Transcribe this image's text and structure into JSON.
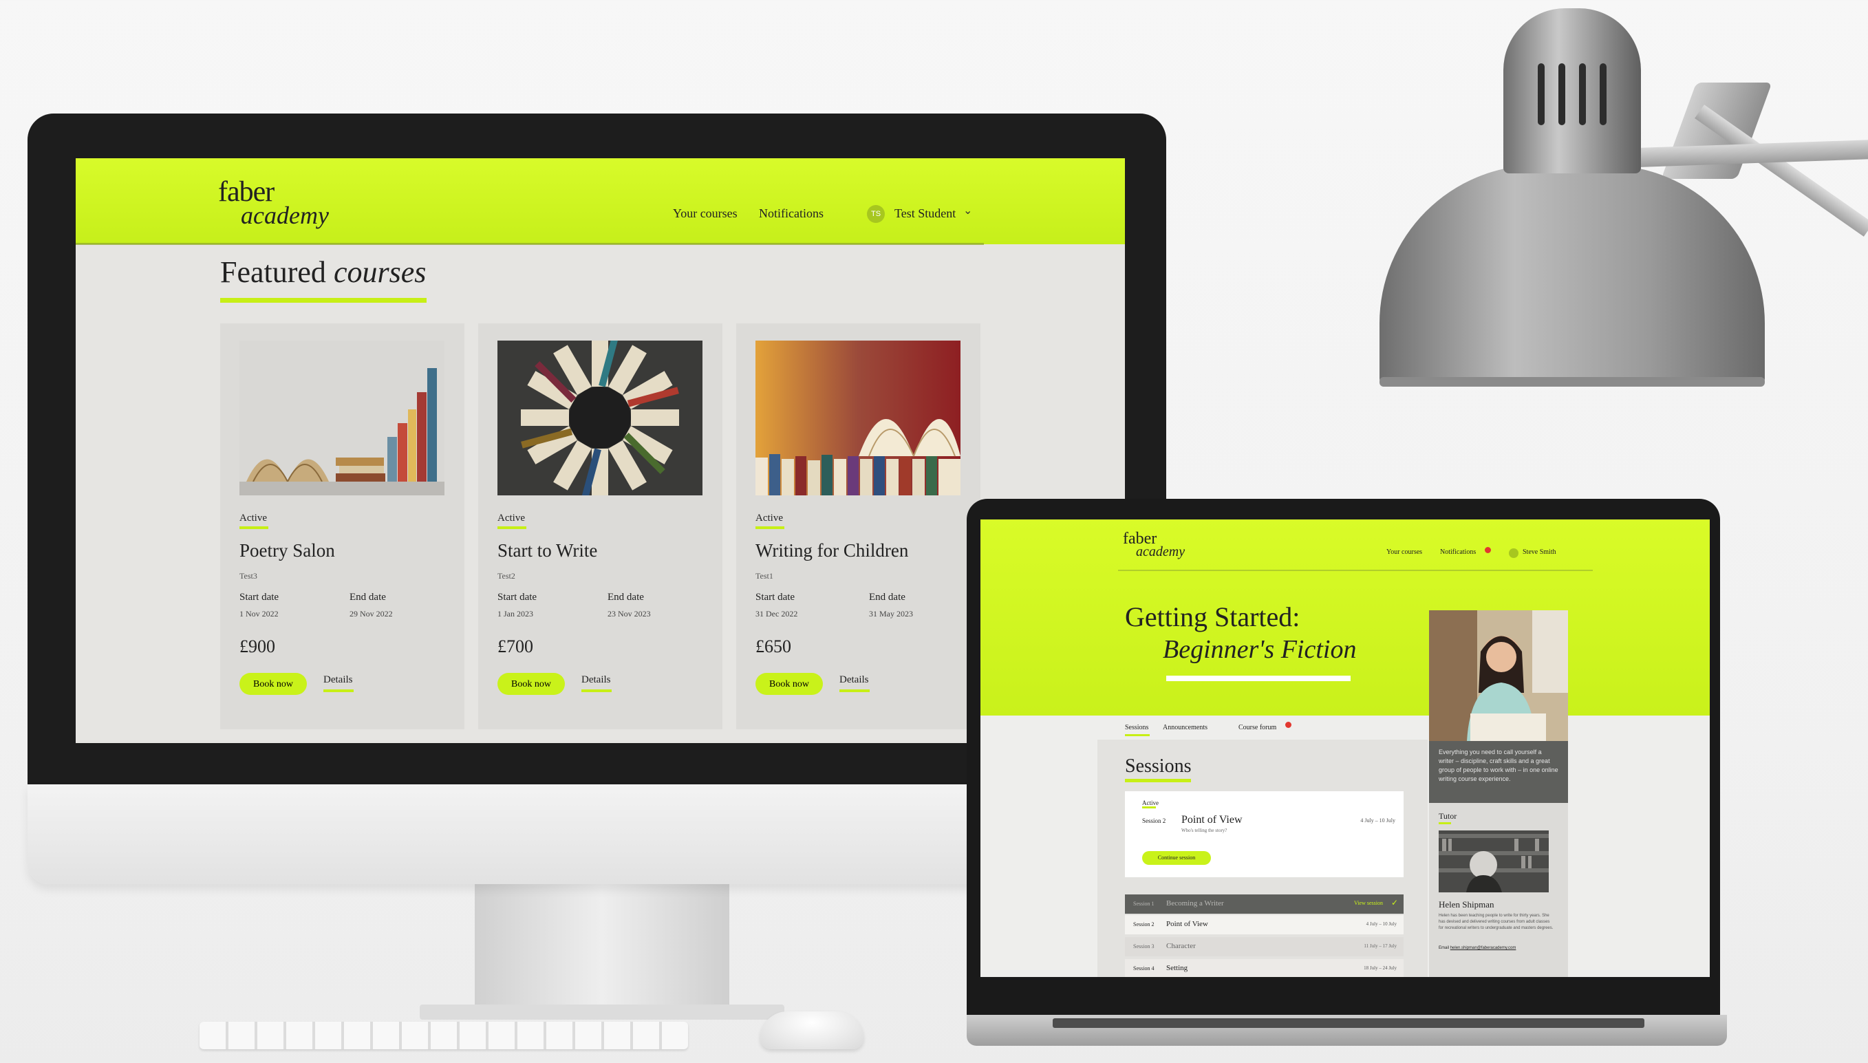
{
  "desktop": {
    "logo_line1": "faber",
    "logo_line2": "academy",
    "nav": {
      "your_courses": "Your courses",
      "notifications": "Notifications",
      "user_initials": "TS",
      "user_name": "Test Student"
    },
    "heading_plain": "Featured ",
    "heading_italic": "courses",
    "cards": [
      {
        "status": "Active",
        "title": "Poetry Salon",
        "code": "Test3",
        "start_label": "Start date",
        "start": "1 Nov 2022",
        "end_label": "End date",
        "end": "29 Nov 2022",
        "price": "£900",
        "book": "Book now",
        "details": "Details"
      },
      {
        "status": "Active",
        "title": "Start to Write",
        "code": "Test2",
        "start_label": "Start date",
        "start": "1 Jan 2023",
        "end_label": "End date",
        "end": "23 Nov 2023",
        "price": "£700",
        "book": "Book now",
        "details": "Details"
      },
      {
        "status": "Active",
        "title": "Writing for Children",
        "code": "Test1",
        "start_label": "Start date",
        "start": "31 Dec 2022",
        "end_label": "End date",
        "end": "31 May 2023",
        "price": "£650",
        "book": "Book now",
        "details": "Details"
      }
    ]
  },
  "laptop": {
    "logo_line1": "faber",
    "logo_line2": "academy",
    "nav": {
      "your_courses": "Your courses",
      "notifications": "Notifications",
      "user_name": "Steve Smith"
    },
    "title_line1": "Getting Started:",
    "title_line2": "Beginner's Fiction",
    "tabs": {
      "sessions": "Sessions",
      "announcements": "Announcements",
      "forum": "Course forum"
    },
    "sessions_heading": "Sessions",
    "current": {
      "status": "Active",
      "num": "Session 2",
      "title": "Point of View",
      "sub": "Who's telling the story?",
      "dates": "4 July – 10 July",
      "button": "Continue session"
    },
    "list": [
      {
        "num": "Session 1",
        "title": "Becoming a Writer",
        "dates": "View session"
      },
      {
        "num": "Session 2",
        "title": "Point of View",
        "dates": "4 July – 10 July"
      },
      {
        "num": "Session 3",
        "title": "Character",
        "dates": "11 July – 17 July"
      },
      {
        "num": "Session 4",
        "title": "Setting",
        "dates": "18 July – 24 July"
      }
    ],
    "side_text": "Everything you need to call yourself a writer – discipline, craft skills and a great group of people to work with – in one online writing course experience.",
    "tutor_label": "Tutor",
    "tutor_name": "Helen Shipman",
    "tutor_bio": "Helen has been teaching people to write for thirty years. She has devised and delivered writing courses from adult classes for recreational writers to undergraduate and masters degrees.",
    "tutor_email_label": "Email",
    "tutor_email": "helen.shipman@faberacademy.com"
  },
  "colors": {
    "accent": "#c9f21a",
    "notification": "#e2372f",
    "panel": "#5e5f5c"
  }
}
